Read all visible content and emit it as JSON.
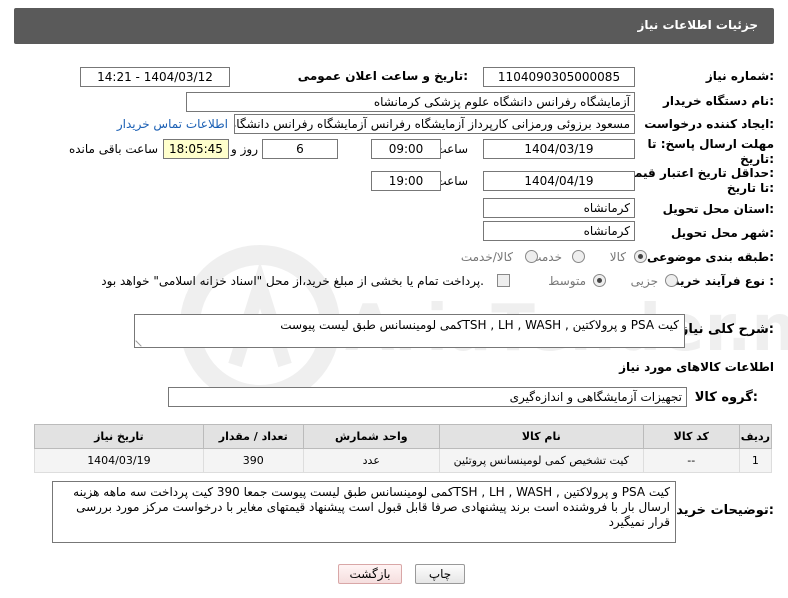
{
  "header": {
    "title": "جزئیات اطلاعات نیاز"
  },
  "fields": {
    "need_number_label": "شماره نیاز:",
    "need_number": "1104090305000085",
    "announce_label": "تاریخ و ساعت اعلان عمومی:",
    "announce_value": "1404/03/12 - 14:21",
    "buyer_org_label": "نام دستگاه خریدار:",
    "buyer_org": "آزمایشگاه رفرانس دانشگاه علوم پزشکی کرمانشاه",
    "creator_label": "ایجاد کننده درخواست:",
    "creator": "مسعود برزوئی ورمزانی کارپرداز آزمایشگاه رفرانس آزمایشگاه رفرانس دانشگاه ع",
    "contact_link": "اطلاعات تماس خریدار",
    "deadline_label_1": "مهلت ارسال پاسخ: تا",
    "deadline_label_2": "تاریخ:",
    "deadline_date": "1404/03/19",
    "time_label": "ساعت",
    "deadline_time": "09:00",
    "days_value": "6",
    "days_label": "روز و",
    "remaining_time": "18:05:45",
    "remaining_label": "ساعت باقی مانده",
    "validity_label_1": "حداقل تاریخ اعتبار قیمت:",
    "validity_label_2": "تا تاریخ:",
    "validity_date": "1404/04/19",
    "validity_time": "19:00",
    "province_label": "استان محل تحویل:",
    "province": "کرمانشاه",
    "city_label": "شهر محل تحویل:",
    "city": "کرمانشاه",
    "category_label": "طبقه بندی موضوعی:",
    "category_options": [
      "کالا",
      "خدمت",
      "کالا/خدمت"
    ],
    "category_selected": "کالا",
    "process_label": "نوع فرآیند خرید :",
    "process_options": [
      "جزیی",
      "متوسط"
    ],
    "process_selected": "متوسط",
    "payment_note": "پرداخت تمام یا بخشی از مبلغ خرید،از محل \"اسناد خزانه اسلامی\" خواهد بود."
  },
  "description": {
    "label": "شرح کلی نیاز:",
    "value": "کیت PSA و پرولاکتین , TSH , LH , WASHکمی لومینسانس طبق لیست پیوست"
  },
  "goods": {
    "section_title": "اطلاعات کالاهای مورد نیاز",
    "group_label": "گروه کالا:",
    "group_value": "تجهیزات آزمایشگاهی و اندازه‌گیری",
    "columns": [
      "ردیف",
      "کد کالا",
      "نام کالا",
      "واحد شمارش",
      "تعداد / مقدار",
      "تاریخ نیاز"
    ],
    "rows": [
      [
        "1",
        "--",
        "کیت تشخیص کمی لومینسانس پروتئین",
        "عدد",
        "390",
        "1404/03/19"
      ]
    ]
  },
  "buyer_notes": {
    "label": "توضیحات خریدار:",
    "value": "کیت PSA و پرولاکتین , TSH , LH , WASHکمی لومینسانس طبق لیست پیوست  جمعا 390 کیت پرداخت سه ماهه هزینه ارسال بار با فروشنده است برند پیشنهادی صرفا قابل قبول است پیشنهاد قیمتهای مغایر با درخواست مرکز مورد بررسی قرار نمیگیرد"
  },
  "buttons": {
    "print": "چاپ",
    "back": "بازگشت"
  },
  "watermark": {
    "text": "AriaTender.neT"
  }
}
